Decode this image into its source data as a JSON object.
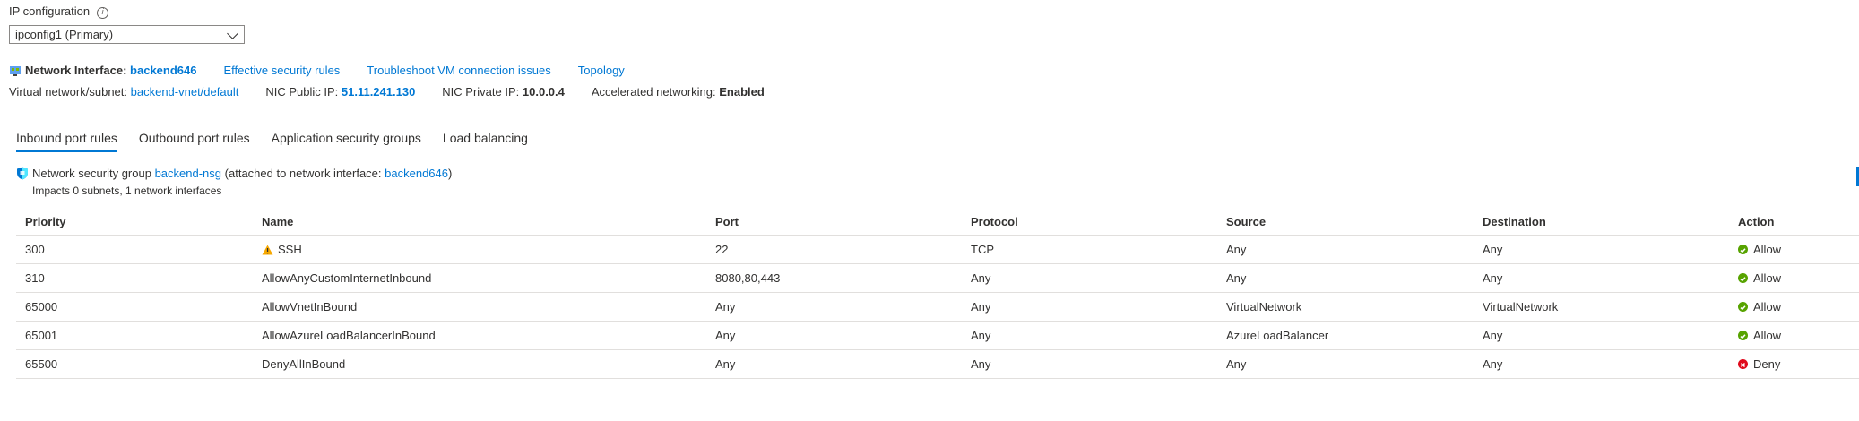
{
  "ip_config": {
    "label": "IP configuration",
    "selected": "ipconfig1 (Primary)"
  },
  "nic": {
    "prefix": "Network Interface:",
    "name": "backend646",
    "links": [
      "Effective security rules",
      "Troubleshoot VM connection issues",
      "Topology"
    ],
    "vnet_label": "Virtual network/subnet:",
    "vnet_value": "backend-vnet/default",
    "public_ip_label": "NIC Public IP:",
    "public_ip_value": "51.11.241.130",
    "private_ip_label": "NIC Private IP:",
    "private_ip_value": "10.0.0.4",
    "accel_label": "Accelerated networking:",
    "accel_value": "Enabled"
  },
  "tabs": [
    {
      "label": "Inbound port rules",
      "active": true
    },
    {
      "label": "Outbound port rules",
      "active": false
    },
    {
      "label": "Application security groups",
      "active": false
    },
    {
      "label": "Load balancing",
      "active": false
    }
  ],
  "nsg": {
    "prefix": "Network security group",
    "name": "backend-nsg",
    "attached_prefix": "(attached to network interface:",
    "attached_nic": "backend646",
    "attached_suffix": ")",
    "impacts": "Impacts 0 subnets, 1 network interfaces"
  },
  "table": {
    "headers": [
      "Priority",
      "Name",
      "Port",
      "Protocol",
      "Source",
      "Destination",
      "Action"
    ],
    "rows": [
      {
        "priority": "300",
        "name": "SSH",
        "warning": true,
        "port": "22",
        "protocol": "TCP",
        "source": "Any",
        "destination": "Any",
        "action": "Allow"
      },
      {
        "priority": "310",
        "name": "AllowAnyCustomInternetInbound",
        "warning": false,
        "port": "8080,80,443",
        "protocol": "Any",
        "source": "Any",
        "destination": "Any",
        "action": "Allow"
      },
      {
        "priority": "65000",
        "name": "AllowVnetInBound",
        "warning": false,
        "port": "Any",
        "protocol": "Any",
        "source": "VirtualNetwork",
        "destination": "VirtualNetwork",
        "action": "Allow"
      },
      {
        "priority": "65001",
        "name": "AllowAzureLoadBalancerInBound",
        "warning": false,
        "port": "Any",
        "protocol": "Any",
        "source": "AzureLoadBalancer",
        "destination": "Any",
        "action": "Allow"
      },
      {
        "priority": "65500",
        "name": "DenyAllInBound",
        "warning": false,
        "port": "Any",
        "protocol": "Any",
        "source": "Any",
        "destination": "Any",
        "action": "Deny"
      }
    ]
  },
  "colors": {
    "link": "#0078d4",
    "allow": "#57a300",
    "deny": "#e00b1c",
    "warning": "#f7a800"
  }
}
